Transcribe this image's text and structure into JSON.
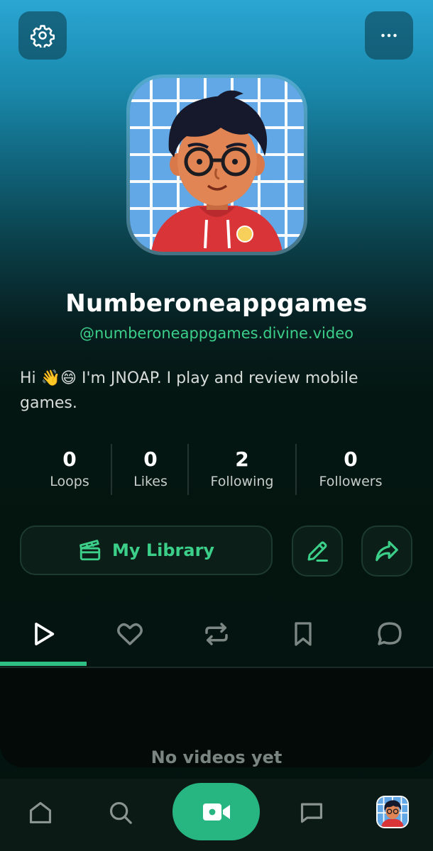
{
  "profile": {
    "display_name": "Numberoneappgames",
    "handle": "@numberoneappgames.divine.video",
    "bio": "Hi 👋😄 I'm JNOAP. I play and review mobile games."
  },
  "stats": [
    {
      "value": "0",
      "label": "Loops"
    },
    {
      "value": "0",
      "label": "Likes"
    },
    {
      "value": "2",
      "label": "Following"
    },
    {
      "value": "0",
      "label": "Followers"
    }
  ],
  "actions": {
    "library_label": "My Library"
  },
  "tabs": [
    {
      "icon": "play-icon",
      "active": true
    },
    {
      "icon": "heart-icon",
      "active": false
    },
    {
      "icon": "repost-icon",
      "active": false
    },
    {
      "icon": "bookmark-icon",
      "active": false
    },
    {
      "icon": "comment-icon",
      "active": false
    }
  ],
  "empty_state": {
    "text": "No videos yet"
  },
  "bottom_nav": [
    "home-icon",
    "search-icon",
    "video-camera-icon",
    "messages-icon",
    "profile-avatar"
  ],
  "colors": {
    "accent": "#3ccf8a",
    "camera_button": "#27b582",
    "background": "#03130f"
  }
}
